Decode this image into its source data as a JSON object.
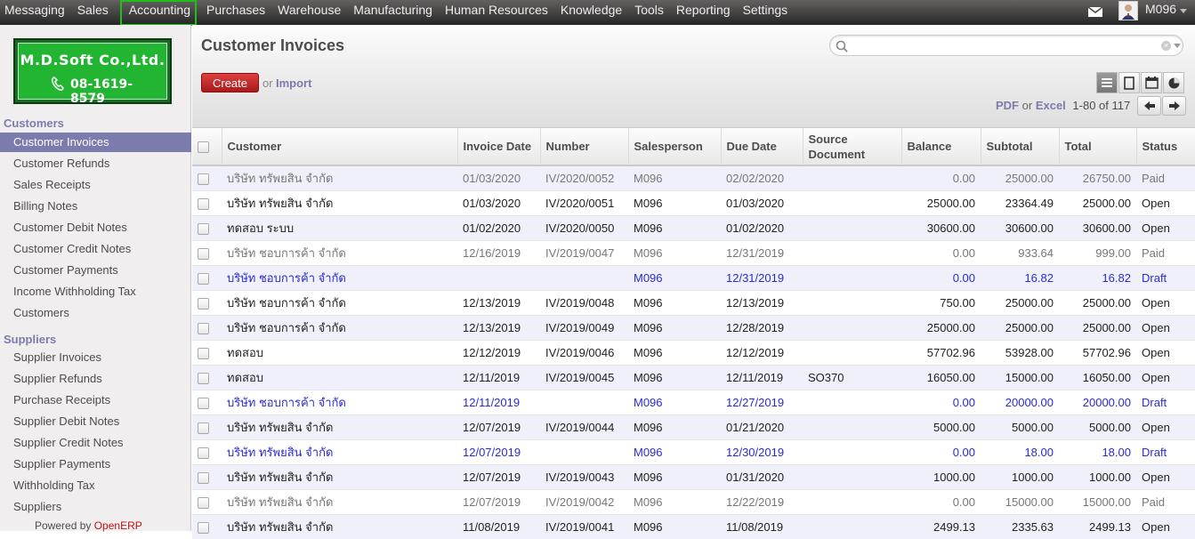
{
  "top_menu": [
    "Messaging",
    "Sales",
    "Accounting",
    "Purchases",
    "Warehouse",
    "Manufacturing",
    "Human Resources",
    "Knowledge",
    "Tools",
    "Reporting",
    "Settings"
  ],
  "top_menu_active": "Accounting",
  "user": {
    "name": "M096"
  },
  "logo": {
    "company": "M.D.Soft Co.,Ltd.",
    "phone": "08-1619-8579"
  },
  "sidebar": {
    "customers_section": "Customers",
    "customers_items": [
      "Customer Invoices",
      "Customer Refunds",
      "Sales Receipts",
      "Billing Notes",
      "Customer Debit Notes",
      "Customer Credit Notes",
      "Customer Payments",
      "Income Withholding Tax",
      "Customers"
    ],
    "suppliers_section": "Suppliers",
    "suppliers_items": [
      "Supplier Invoices",
      "Supplier Refunds",
      "Purchase Receipts",
      "Supplier Debit Notes",
      "Supplier Credit Notes",
      "Supplier Payments",
      "Withholding Tax",
      "Suppliers"
    ],
    "powered_prefix": "Powered by",
    "powered_brand": "OpenERP"
  },
  "page": {
    "title": "Customer Invoices",
    "create_label": "Create",
    "or_label": "or",
    "import_label": "Import",
    "pdf_label": "PDF",
    "excel_label": "Excel",
    "pager": "1-80 of 117"
  },
  "table": {
    "headers": [
      "Customer",
      "Invoice Date",
      "Number",
      "Salesperson",
      "Due Date",
      "Source Document",
      "Balance",
      "Subtotal",
      "Total",
      "Status"
    ],
    "rows": [
      {
        "customer": "บริษัท ทรัพยสิน จำกัด",
        "invoice_date": "01/03/2020",
        "number": "IV/2020/0052",
        "salesperson": "M096",
        "due_date": "02/02/2020",
        "source": "",
        "balance": "0.00",
        "subtotal": "25000.00",
        "total": "26750.00",
        "status": "Paid"
      },
      {
        "customer": "บริษัท ทรัพยสิน จำกัด",
        "invoice_date": "01/03/2020",
        "number": "IV/2020/0051",
        "salesperson": "M096",
        "due_date": "01/03/2020",
        "source": "",
        "balance": "25000.00",
        "subtotal": "23364.49",
        "total": "25000.00",
        "status": "Open"
      },
      {
        "customer": "ทดสอบ ระบบ",
        "invoice_date": "01/02/2020",
        "number": "IV/2020/0050",
        "salesperson": "M096",
        "due_date": "01/02/2020",
        "source": "",
        "balance": "30600.00",
        "subtotal": "30600.00",
        "total": "30600.00",
        "status": "Open"
      },
      {
        "customer": "บริษัท ชอบการค้า จำกัด",
        "invoice_date": "12/16/2019",
        "number": "IV/2019/0047",
        "salesperson": "M096",
        "due_date": "12/31/2019",
        "source": "",
        "balance": "0.00",
        "subtotal": "933.64",
        "total": "999.00",
        "status": "Paid"
      },
      {
        "customer": "บริษัท ชอบการค้า จำกัด",
        "invoice_date": "",
        "number": "",
        "salesperson": "M096",
        "due_date": "12/31/2019",
        "source": "",
        "balance": "0.00",
        "subtotal": "16.82",
        "total": "16.82",
        "status": "Draft"
      },
      {
        "customer": "บริษัท ชอบการค้า จำกัด",
        "invoice_date": "12/13/2019",
        "number": "IV/2019/0048",
        "salesperson": "M096",
        "due_date": "12/13/2019",
        "source": "",
        "balance": "750.00",
        "subtotal": "25000.00",
        "total": "25000.00",
        "status": "Open"
      },
      {
        "customer": "บริษัท ชอบการค้า จำกัด",
        "invoice_date": "12/13/2019",
        "number": "IV/2019/0049",
        "salesperson": "M096",
        "due_date": "12/28/2019",
        "source": "",
        "balance": "25000.00",
        "subtotal": "25000.00",
        "total": "25000.00",
        "status": "Open"
      },
      {
        "customer": "ทดสอบ",
        "invoice_date": "12/12/2019",
        "number": "IV/2019/0046",
        "salesperson": "M096",
        "due_date": "12/12/2019",
        "source": "",
        "balance": "57702.96",
        "subtotal": "53928.00",
        "total": "57702.96",
        "status": "Open"
      },
      {
        "customer": "ทดสอบ",
        "invoice_date": "12/11/2019",
        "number": "IV/2019/0045",
        "salesperson": "M096",
        "due_date": "12/11/2019",
        "source": "SO370",
        "balance": "16050.00",
        "subtotal": "15000.00",
        "total": "16050.00",
        "status": "Open"
      },
      {
        "customer": "บริษัท ชอบการค้า จำกัด",
        "invoice_date": "12/11/2019",
        "number": "",
        "salesperson": "M096",
        "due_date": "12/27/2019",
        "source": "",
        "balance": "0.00",
        "subtotal": "20000.00",
        "total": "20000.00",
        "status": "Draft"
      },
      {
        "customer": "บริษัท ทรัพยสิน จำกัด",
        "invoice_date": "12/07/2019",
        "number": "IV/2019/0044",
        "salesperson": "M096",
        "due_date": "01/21/2020",
        "source": "",
        "balance": "5000.00",
        "subtotal": "5000.00",
        "total": "5000.00",
        "status": "Open"
      },
      {
        "customer": "บริษัท ทรัพยสิน จำกัด",
        "invoice_date": "12/07/2019",
        "number": "",
        "salesperson": "M096",
        "due_date": "12/30/2019",
        "source": "",
        "balance": "0.00",
        "subtotal": "18.00",
        "total": "18.00",
        "status": "Draft"
      },
      {
        "customer": "บริษัท ทรัพยสิน จำกัด",
        "invoice_date": "12/07/2019",
        "number": "IV/2019/0043",
        "salesperson": "M096",
        "due_date": "01/31/2020",
        "source": "",
        "balance": "1000.00",
        "subtotal": "1000.00",
        "total": "1000.00",
        "status": "Open"
      },
      {
        "customer": "บริษัท ทรัพยสิน จำกัด",
        "invoice_date": "12/07/2019",
        "number": "IV/2019/0042",
        "salesperson": "M096",
        "due_date": "12/22/2019",
        "source": "",
        "balance": "0.00",
        "subtotal": "15000.00",
        "total": "15000.00",
        "status": "Paid"
      },
      {
        "customer": "บริษัท ทรัพยสิน จำกัด",
        "invoice_date": "11/08/2019",
        "number": "IV/2019/0041",
        "salesperson": "M096",
        "due_date": "11/08/2019",
        "source": "",
        "balance": "2499.13",
        "subtotal": "2335.63",
        "total": "2499.13",
        "status": "Open"
      }
    ]
  },
  "icons": {
    "mail": "envelope-icon",
    "search": "search-icon",
    "list_view": "list-view-icon",
    "form_view": "form-view-icon",
    "calendar_view": "calendar-view-icon",
    "graph_view": "graph-view-icon",
    "prev": "arrow-left-icon",
    "next": "arrow-right-icon"
  },
  "colors": {
    "accent": "#7c7bad",
    "create_button": "#c62c2c",
    "active_highlight": "#1fc01a",
    "draft_text": "#2a2ad4"
  }
}
